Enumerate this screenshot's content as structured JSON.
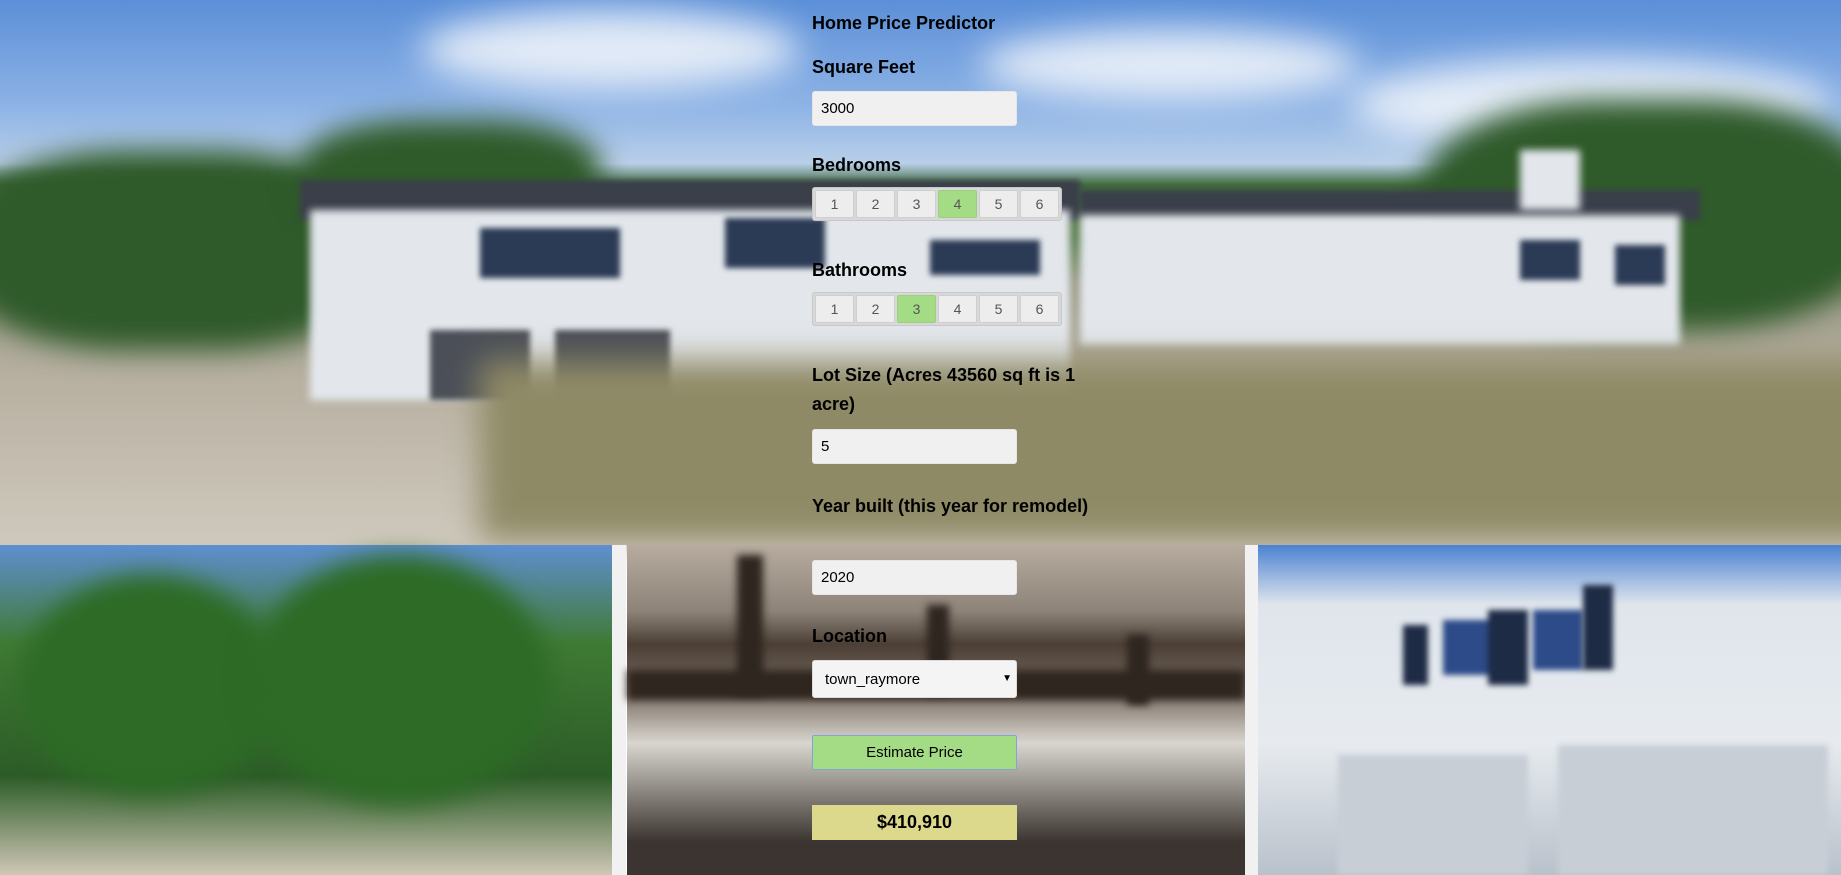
{
  "app": {
    "title": "Home Price Predictor"
  },
  "fields": {
    "square_feet": {
      "label": "Square Feet",
      "value": "3000"
    },
    "bedrooms": {
      "label": "Bedrooms",
      "options": [
        "1",
        "2",
        "3",
        "4",
        "5",
        "6"
      ],
      "selected": "4"
    },
    "bathrooms": {
      "label": "Bathrooms",
      "options": [
        "1",
        "2",
        "3",
        "4",
        "5",
        "6"
      ],
      "selected": "3"
    },
    "lot_size": {
      "label": "Lot Size (Acres 43560 sq ft is 1 acre)",
      "value": "5"
    },
    "year_built": {
      "label": "Year built (this year for remodel)",
      "value": "2020"
    },
    "location": {
      "label": "Location",
      "value": "town_raymore"
    }
  },
  "actions": {
    "estimate_label": "Estimate Price"
  },
  "result": {
    "value": "$410,910"
  },
  "colors": {
    "accent": "#a4dc86",
    "result_bg": "#dcd98c"
  },
  "icons": {
    "select_arrow": "chevron-down-icon"
  }
}
